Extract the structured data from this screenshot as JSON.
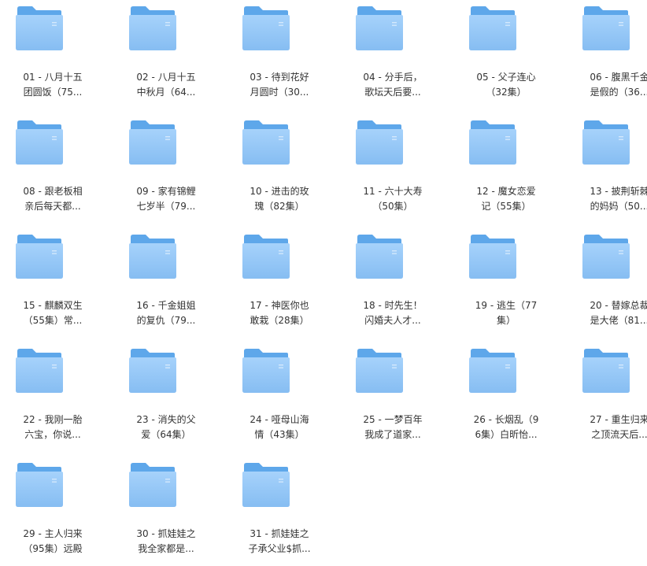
{
  "colors": {
    "folder_front_top": "#a6d2fb",
    "folder_front_bottom": "#86bdf2",
    "folder_back": "#5ea7ea",
    "label_text": "#333333",
    "background": "#ffffff"
  },
  "folders": [
    {
      "line1": "01 - 八月十五",
      "line2": "团圆饭（75..."
    },
    {
      "line1": "02 - 八月十五",
      "line2": "中秋月（64..."
    },
    {
      "line1": "03 - 待到花好",
      "line2": "月圆时（30..."
    },
    {
      "line1": "04 - 分手后，",
      "line2": "歌坛天后要..."
    },
    {
      "line1": "05 - 父子连心",
      "line2": "（32集）"
    },
    {
      "line1": "06 - 腹黑千金",
      "line2": "是假的（36..."
    },
    {
      "line1": "08 - 跟老板相",
      "line2": "亲后每天都..."
    },
    {
      "line1": "09 - 家有锦鲤",
      "line2": "七岁半（79..."
    },
    {
      "line1": "10 - 进击的玫",
      "line2": "瑰（82集）"
    },
    {
      "line1": "11 - 六十大寿",
      "line2": "（50集）"
    },
    {
      "line1": "12 - 魔女恋爱",
      "line2": "记（55集）"
    },
    {
      "line1": "13 - 披荆斩棘",
      "line2": "的妈妈（50..."
    },
    {
      "line1": "15 - 麒麟双生",
      "line2": "（55集）常..."
    },
    {
      "line1": "16 - 千金姐姐",
      "line2": "的复仇（79..."
    },
    {
      "line1": "17 - 神医你也",
      "line2": "敢栽（28集）"
    },
    {
      "line1": "18 - 时先生！",
      "line2": "闪婚夫人才..."
    },
    {
      "line1": "19 - 逃生（77",
      "line2": "集）"
    },
    {
      "line1": "20 - 替嫁总裁",
      "line2": "是大佬（81..."
    },
    {
      "line1": "22 - 我刚一胎",
      "line2": "六宝，你说..."
    },
    {
      "line1": "23 - 消失的父",
      "line2": "爱（64集）"
    },
    {
      "line1": "24 - 哑母山海",
      "line2": "情（43集）"
    },
    {
      "line1": "25 - 一梦百年",
      "line2": "我成了道家..."
    },
    {
      "line1": "26 - 长烟乱（9",
      "line2": "6集）白昕怡..."
    },
    {
      "line1": "27 - 重生归来",
      "line2": "之顶流天后..."
    },
    {
      "line1": "29 - 主人归来",
      "line2": "（95集）远殿"
    },
    {
      "line1": "30 - 抓娃娃之",
      "line2": "我全家都是..."
    },
    {
      "line1": "31 - 抓娃娃之",
      "line2": "子承父业$抓..."
    }
  ]
}
